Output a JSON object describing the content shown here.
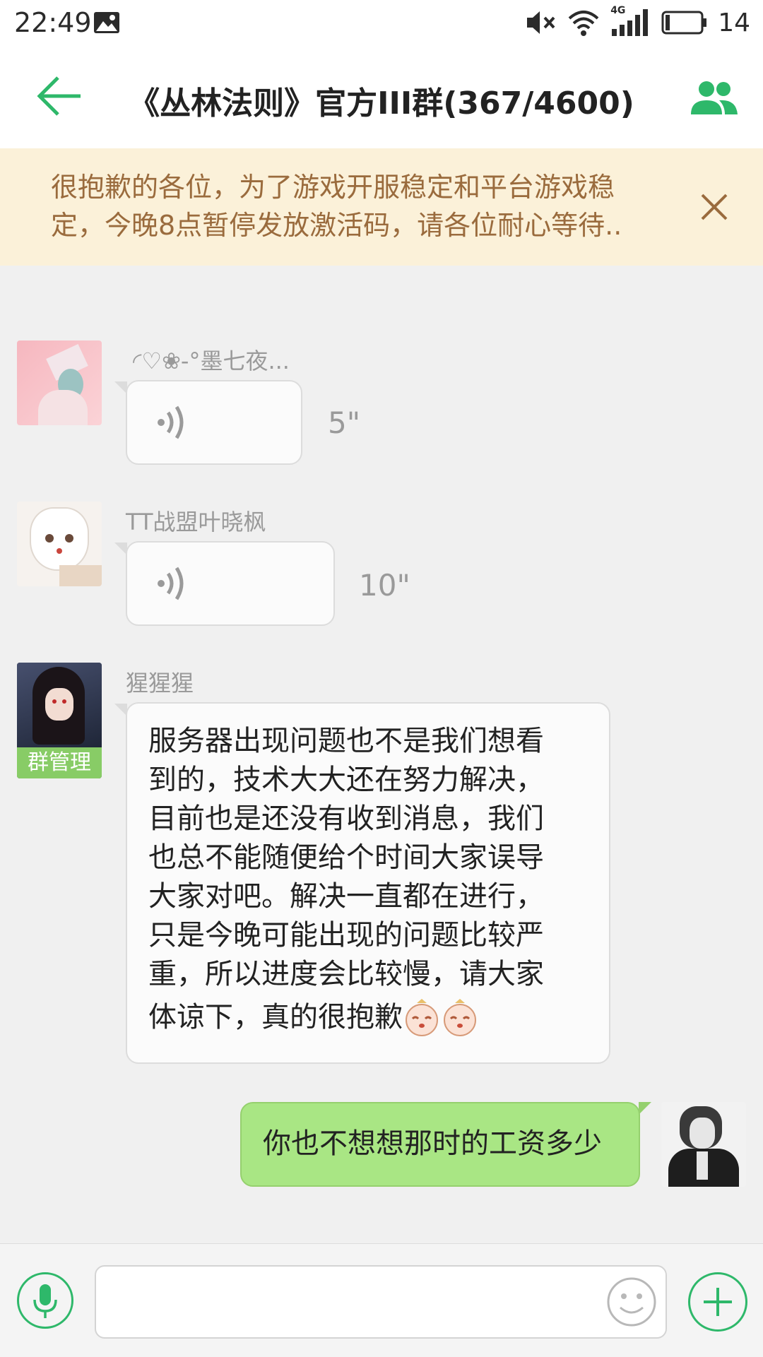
{
  "status_bar": {
    "time": "22:49",
    "battery_level": "14",
    "network_label": "4G",
    "icons": [
      "image-notification-icon",
      "mute-icon",
      "wifi-icon",
      "signal-icon",
      "battery-icon"
    ]
  },
  "header": {
    "title": "《丛林法则》官方III群(367/4600)",
    "back_icon": "arrow-left-icon",
    "members_icon": "group-members-icon",
    "accent_color": "#2eb86a"
  },
  "notice": {
    "line1": "很抱歉的各位，为了游戏开服稳定和平台游戏稳",
    "line2": "定，今晚8点暂停发放激活码，请各位耐心等待..",
    "close_icon": "close-icon"
  },
  "messages": [
    {
      "sender": "◜♡❀-°墨七夜...",
      "type": "voice",
      "duration": "5\""
    },
    {
      "sender": "TT战盟叶晓枫",
      "type": "voice",
      "duration": "10\""
    },
    {
      "sender": "猩猩猩",
      "badge": "群管理",
      "type": "text",
      "lines": [
        "服务器出现问题也不是我们想看",
        "到的，技术大大还在努力解决，",
        "目前也是还没有收到消息，我们",
        "也总不能随便给个时间大家误导",
        "大家对吧。解决一直都在进行，",
        "只是今晚可能出现的问题比较严",
        "重，所以进度会比较慢，请大家",
        "体谅下，真的很抱歉"
      ],
      "emoji": [
        "sad-face-emoji",
        "sad-face-emoji"
      ]
    },
    {
      "sender": "self",
      "type": "text",
      "text": "你也不想想那时的工资多少"
    }
  ],
  "input_bar": {
    "placeholder": "",
    "value": "",
    "mic_icon": "microphone-icon",
    "emoji_icon": "smiley-icon",
    "plus_icon": "plus-icon"
  },
  "colors": {
    "bubble_out": "#a9e684",
    "bubble_in": "#fbfbfb",
    "notice_bg": "#fbf1d9",
    "notice_text": "#9a6b3d",
    "admin_badge": "#88cc66"
  }
}
